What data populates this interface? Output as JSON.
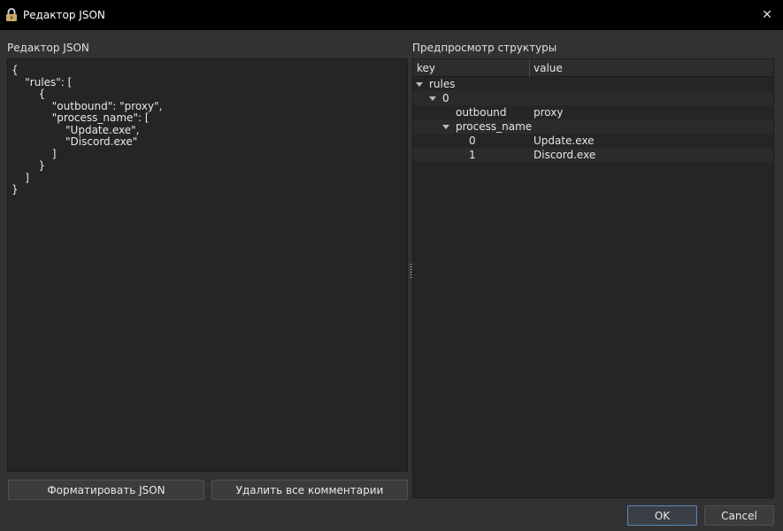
{
  "window": {
    "title": "Редактор JSON",
    "close_glyph": "✕"
  },
  "left_panel": {
    "label": "Редактор JSON",
    "editor_text": "{\n    \"rules\": [\n        {\n            \"outbound\": \"proxy\",\n            \"process_name\": [\n                \"Update.exe\",\n                \"Discord.exe\"\n            ]\n        }\n    ]\n}",
    "format_button": "Форматировать JSON",
    "remove_comments_button": "Удалить все комментарии"
  },
  "right_panel": {
    "label": "Предпросмотр структуры",
    "columns": {
      "key": "key",
      "value": "value"
    },
    "rows": [
      {
        "key": "rules",
        "value": ""
      },
      {
        "key": "0",
        "value": ""
      },
      {
        "key": "outbound",
        "value": "proxy"
      },
      {
        "key": "process_name",
        "value": ""
      },
      {
        "key": "0",
        "value": "Update.exe"
      },
      {
        "key": "1",
        "value": "Discord.exe"
      }
    ]
  },
  "footer": {
    "ok_button": "OK",
    "cancel_button": "Cancel"
  },
  "colors": {
    "background": "#323232",
    "titlebar": "#000000",
    "panel": "#252525",
    "accent": "#5a86b8"
  }
}
